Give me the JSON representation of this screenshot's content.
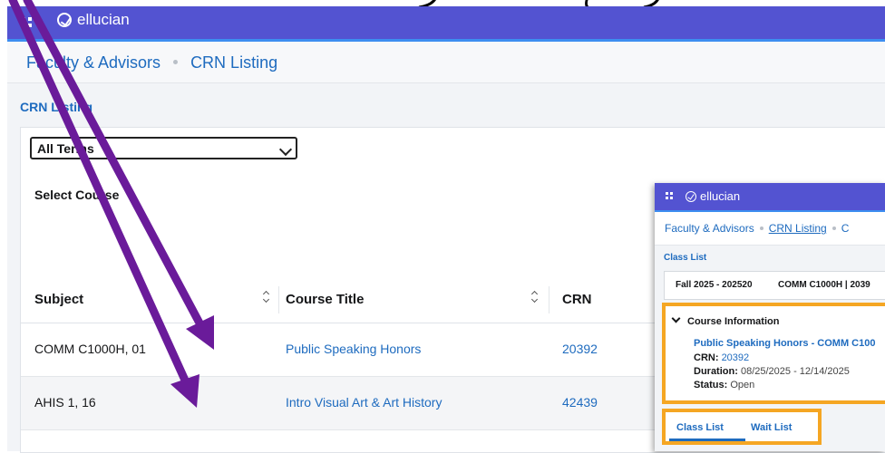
{
  "app": {
    "brand": "ellucian"
  },
  "breadcrumb": {
    "parent": "Faculty & Advisors",
    "current": "CRN Listing"
  },
  "page": {
    "title": "CRN Listing"
  },
  "term_select": {
    "value": "All Terms"
  },
  "select_course_label": "Select Course",
  "table": {
    "headers": {
      "subject": "Subject",
      "course_title": "Course Title",
      "crn": "CRN"
    },
    "rows": [
      {
        "subject": "COMM C1000H, 01",
        "course_title": "Public Speaking Honors",
        "crn": "20392"
      },
      {
        "subject": "AHIS 1, 16",
        "course_title": "Intro Visual Art & Art History",
        "crn": "42439"
      }
    ]
  },
  "inset": {
    "brand": "ellucian",
    "breadcrumb": {
      "parent": "Faculty & Advisors",
      "middle": "CRN Listing",
      "current": "C"
    },
    "class_list_title": "Class List",
    "term": "Fall 2025 - 202520",
    "course": "COMM C1000H | 2039",
    "course_info": {
      "header": "Course Information",
      "title": "Public Speaking Honors - COMM C100",
      "crn_label": "CRN:",
      "crn_value": "20392",
      "duration_label": "Duration:",
      "duration_value": "08/25/2025 - 12/14/2025",
      "status_label": "Status:",
      "status_value": "Open"
    },
    "tabs": [
      "Class List",
      "Wait List"
    ]
  },
  "colors": {
    "header_bg": "#5353d1",
    "link": "#1e6bbf",
    "highlight_box": "#f5a623",
    "annotation_arrow": "#6a1b9a"
  },
  "icons": [
    "app-grid-icon",
    "ellucian-logo-icon",
    "chevron-down-icon",
    "sort-icon"
  ]
}
